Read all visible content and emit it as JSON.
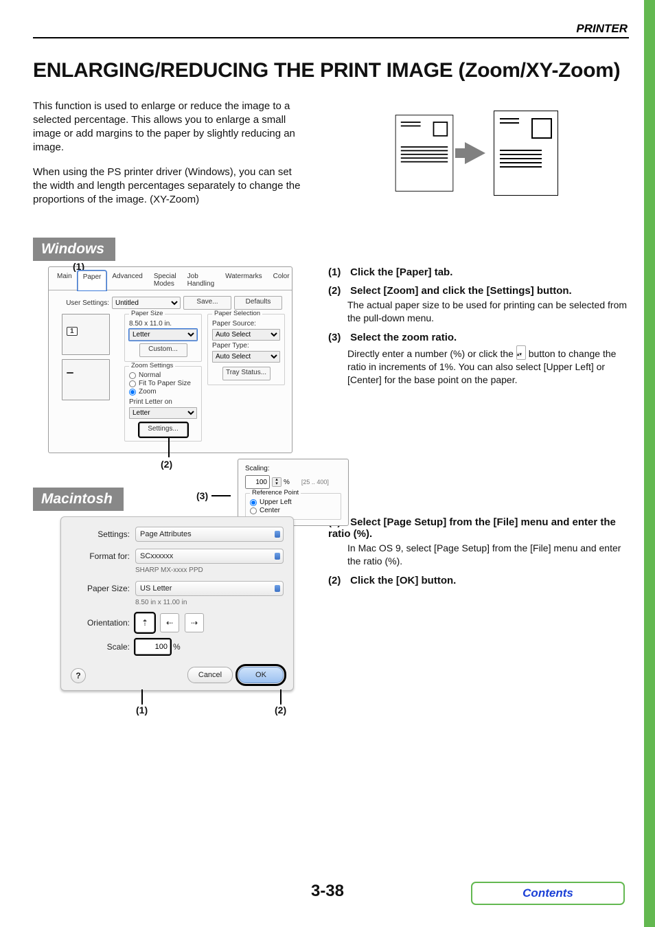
{
  "header": {
    "label": "PRINTER"
  },
  "title": "ENLARGING/REDUCING THE PRINT IMAGE (Zoom/XY-Zoom)",
  "intro": {
    "p1": "This function is used to enlarge or reduce the image to a selected percentage. This allows you to enlarge a small image or add margins to the paper by slightly reducing an image.",
    "p2": "When using the PS printer driver (Windows), you can set the width and length percentages separately to change the proportions of the image. (XY-Zoom)"
  },
  "sections": {
    "windows": "Windows",
    "macintosh": "Macintosh"
  },
  "win_callouts": {
    "c1": "(1)",
    "c2": "(2)",
    "c3": "(3)"
  },
  "win_dialog": {
    "tabs": [
      "Main",
      "Paper",
      "Advanced",
      "Special Modes",
      "Job Handling",
      "Watermarks",
      "Color"
    ],
    "active_tab_index": 1,
    "user_settings_label": "User Settings:",
    "user_settings_value": "Untitled",
    "save_btn": "Save...",
    "defaults_btn": "Defaults",
    "paper_size": {
      "legend": "Paper Size",
      "info": "8.50 x 11.0 in.",
      "value": "Letter",
      "custom_btn": "Custom..."
    },
    "zoom": {
      "legend": "Zoom Settings",
      "opts": [
        "Normal",
        "Fit To Paper Size",
        "Zoom"
      ],
      "selected": 2,
      "print_label": "Print Letter on",
      "print_value": "Letter",
      "settings_btn": "Settings..."
    },
    "paper_sel": {
      "legend": "Paper Selection",
      "source_label": "Paper Source:",
      "source_value": "Auto Select",
      "type_label": "Paper Type:",
      "type_value": "Auto Select",
      "tray_btn": "Tray Status..."
    },
    "popup": {
      "scaling_label": "Scaling:",
      "scaling_value": "100",
      "unit": "%",
      "range": "[25 .. 400]",
      "ref_legend": "Reference Point",
      "opts": [
        "Upper Left",
        "Center"
      ],
      "selected": 0
    }
  },
  "win_steps": {
    "s1": {
      "num": "(1)",
      "title": "Click the [Paper] tab."
    },
    "s2": {
      "num": "(2)",
      "title": "Select [Zoom] and click the [Settings] button.",
      "detail": "The actual paper size to be used for printing can be selected from the pull-down menu."
    },
    "s3": {
      "num": "(3)",
      "title": "Select the zoom ratio.",
      "pre": "Directly enter a number (%) or click the ",
      "post": " button to change the ratio in increments of 1%. You can also select [Upper Left] or [Center] for the base point on the paper."
    }
  },
  "mac_dialog": {
    "settings_label": "Settings:",
    "settings_value": "Page Attributes",
    "format_label": "Format for:",
    "format_value": "SCxxxxxx",
    "format_sub": "SHARP MX-xxxx PPD",
    "papersize_label": "Paper Size:",
    "papersize_value": "US Letter",
    "papersize_sub": "8.50 in x 11.00 in",
    "orientation_label": "Orientation:",
    "scale_label": "Scale:",
    "scale_value": "100",
    "scale_unit": "%",
    "help": "?",
    "cancel": "Cancel",
    "ok": "OK"
  },
  "mac_callouts": {
    "c1": "(1)",
    "c2": "(2)"
  },
  "mac_steps": {
    "s1": {
      "num": "(1)",
      "title": "Select [Page Setup] from the [File] menu and enter the ratio (%).",
      "detail": "In Mac OS 9, select [Page Setup] from the [File] menu and enter the ratio (%)."
    },
    "s2": {
      "num": "(2)",
      "title": "Click the [OK] button."
    }
  },
  "footer": {
    "page": "3-38",
    "contents": "Contents"
  }
}
